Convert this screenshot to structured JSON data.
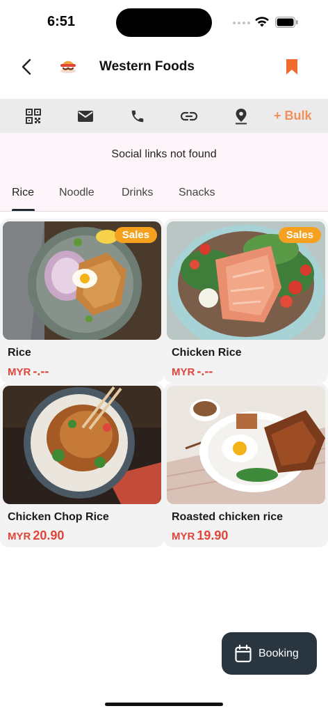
{
  "status_bar": {
    "time": "6:51"
  },
  "header": {
    "title": "Western Foods"
  },
  "icon_bar": {
    "icons": [
      "qr-code-icon",
      "mail-icon",
      "phone-icon",
      "link-icon",
      "location-pin-icon"
    ],
    "bulk_label": "+ Bulk",
    "bulk_color": "#f0905a"
  },
  "social": {
    "message": "Social links not found"
  },
  "tabs": [
    {
      "label": "Rice",
      "active": true
    },
    {
      "label": "Noodle",
      "active": false
    },
    {
      "label": "Drinks",
      "active": false
    },
    {
      "label": "Snacks",
      "active": false
    }
  ],
  "products": [
    {
      "name": "Rice",
      "currency": "MYR",
      "price": "-.--",
      "badge": "Sales"
    },
    {
      "name": "Chicken Rice",
      "currency": "MYR",
      "price": "-.--",
      "badge": "Sales"
    },
    {
      "name": "Chicken Chop Rice",
      "currency": "MYR",
      "price": "20.90",
      "badge": ""
    },
    {
      "name": "Roasted chicken rice",
      "currency": "MYR",
      "price": "19.90",
      "badge": ""
    }
  ],
  "booking": {
    "label": "Booking"
  },
  "colors": {
    "accent": "#f0905a",
    "price": "#e0453a",
    "badge": "#f5a11f",
    "booking_bg": "#293640",
    "bookmark": "#f26a2e"
  }
}
